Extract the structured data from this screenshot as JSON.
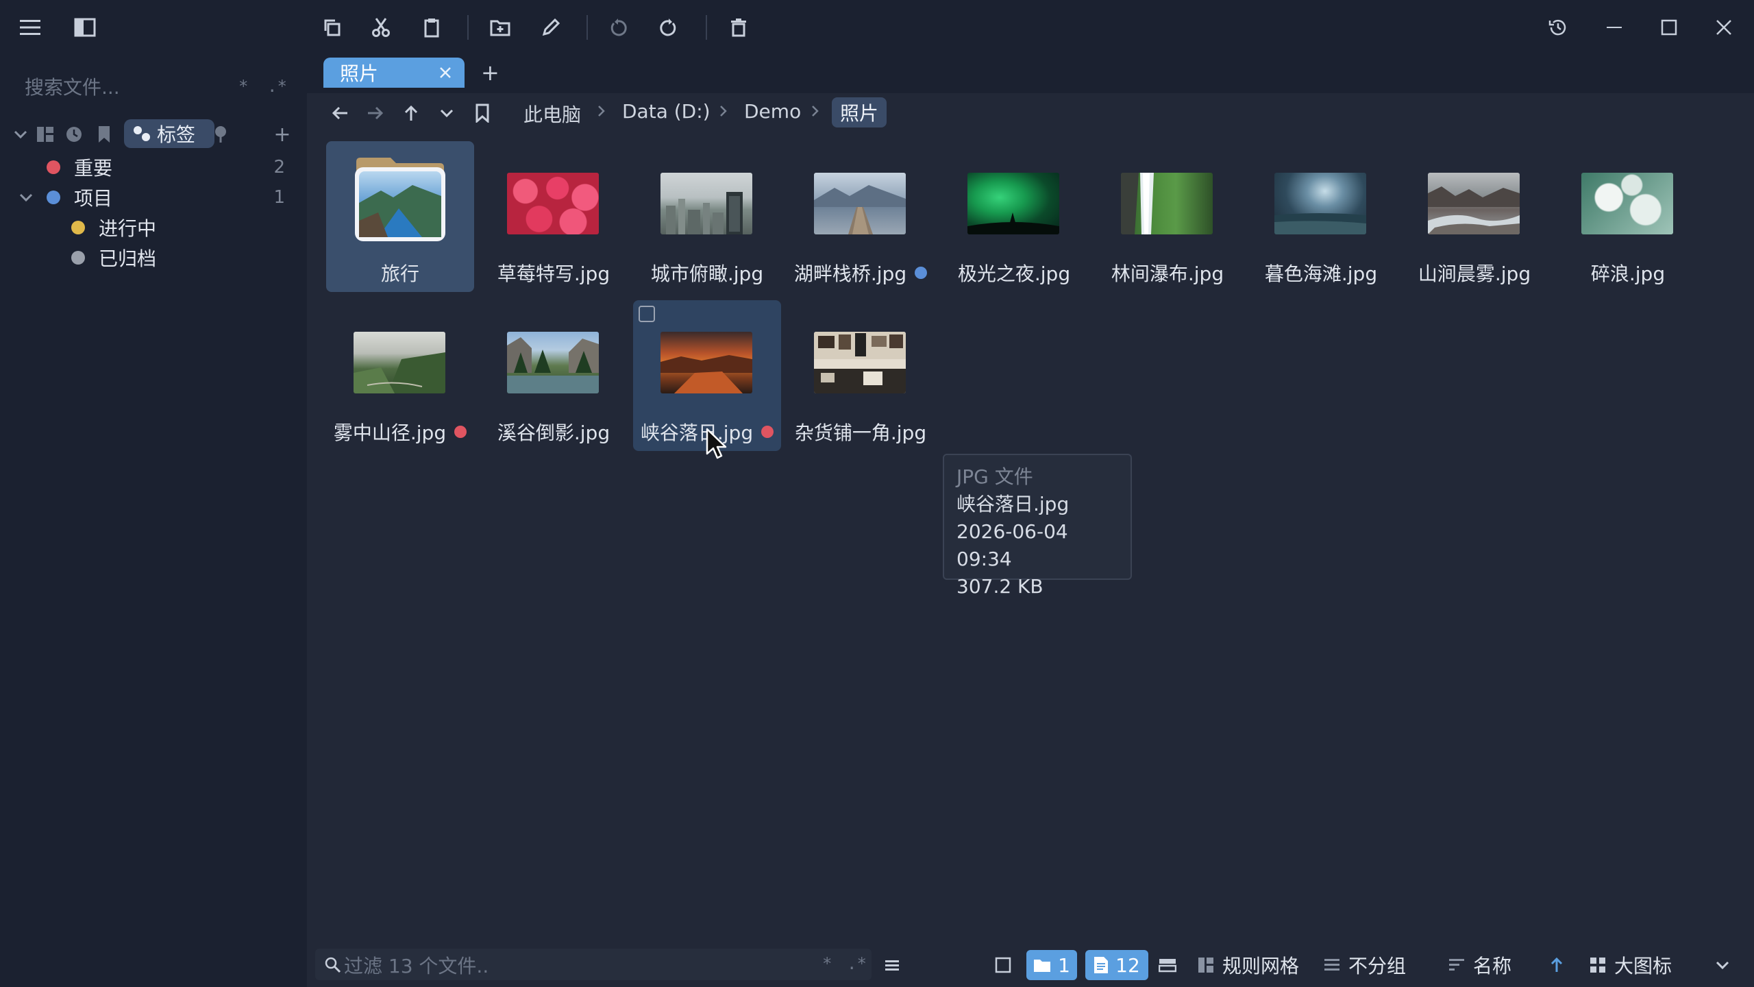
{
  "window": {
    "tab_label": "照片",
    "new_tab_label": "+"
  },
  "sidebar": {
    "search_placeholder": "搜索文件...",
    "search_flag_wildcard": "*",
    "search_flag_regex": ".*",
    "tag_tab_label": "标签",
    "add_label": "+",
    "tags": [
      {
        "label": "重要",
        "count": "2",
        "color": "#e05561"
      },
      {
        "label": "项目",
        "count": "1",
        "color": "#5b8fd8"
      },
      {
        "label": "进行中",
        "count": "",
        "color": "#e0b94a"
      },
      {
        "label": "已归档",
        "count": "",
        "color": "#9aa0ab"
      }
    ]
  },
  "breadcrumb": [
    "此电脑",
    "Data (D:)",
    "Demo",
    "照片"
  ],
  "files": [
    {
      "name": "旅行",
      "type": "folder"
    },
    {
      "name": "草莓特写.jpg"
    },
    {
      "name": "城市俯瞰.jpg"
    },
    {
      "name": "湖畔栈桥.jpg",
      "tag_color": "#5b8fd8"
    },
    {
      "name": "极光之夜.jpg"
    },
    {
      "name": "林间瀑布.jpg"
    },
    {
      "name": "暮色海滩.jpg"
    },
    {
      "name": "山涧晨雾.jpg"
    },
    {
      "name": "碎浪.jpg"
    },
    {
      "name": "雾中山径.jpg",
      "tag_color": "#e05561"
    },
    {
      "name": "溪谷倒影.jpg"
    },
    {
      "name": "峡谷落日.jpg",
      "tag_color": "#e05561"
    },
    {
      "name": "杂货铺一角.jpg"
    }
  ],
  "tooltip": {
    "type": "JPG 文件",
    "name": "峡谷落日.jpg",
    "modified": "2026-06-04 09:34",
    "size": "307.2 KB"
  },
  "status": {
    "filter_placeholder": "过滤 13 个文件..",
    "filter_flag_wildcard": "*",
    "filter_flag_regex": ".*",
    "folder_count": "1",
    "file_count": "12",
    "layout_label": "规则网格",
    "group_label": "不分组",
    "sort_label": "名称",
    "view_label": "大图标"
  },
  "colors": {
    "accent": "#5b9fe0",
    "tag_red": "#e05561",
    "tag_blue": "#5b8fd8",
    "tag_yellow": "#e0b94a",
    "tag_gray": "#9aa0ab"
  }
}
